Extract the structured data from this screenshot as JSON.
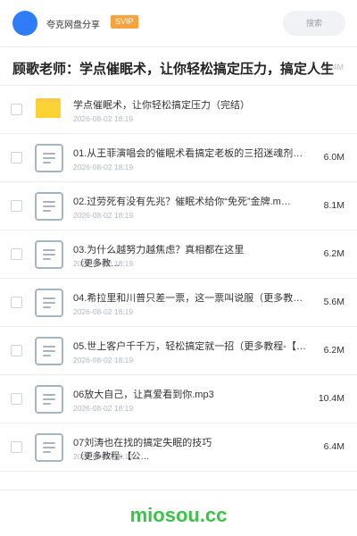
{
  "header": {
    "share_name": "夸克网盘分享",
    "badge": "SVIP",
    "search_label": "搜索"
  },
  "title": {
    "text": "顾歌老师：学点催眠术，让你轻松搞定压力，搞定人生",
    "size": "58.4M"
  },
  "files": [
    {
      "name": "学点催眠术，让你轻松搞定压力（完结）",
      "name2": "",
      "date": "2026-08-02 18:19",
      "size": "",
      "type": "folder"
    },
    {
      "name": "01.从王菲演唱会的催眠术看搞定老板的三招迷魂剂…",
      "name2": "",
      "date": "2026-08-02 18:19",
      "size": "6.0M",
      "type": "doc"
    },
    {
      "name": "02.过劳死有没有先兆？催眠术给你“免死”金牌.m…",
      "name2": "",
      "date": "2026-08-02 18:19",
      "size": "8.1M",
      "type": "doc"
    },
    {
      "name": "03.为什么越努力越焦虑？真相都在这里",
      "name2": "（更多教…",
      "date": "2026-08-02 18:19",
      "size": "6.2M",
      "type": "doc"
    },
    {
      "name": "04.希拉里和川普只差一票，这一票叫说服（更多教程…",
      "name2": "",
      "date": "2026-08-02 18:19",
      "size": "5.6M",
      "type": "doc"
    },
    {
      "name": "05.世上客户千千万，轻松搞定就一招（更多教程-【…",
      "name2": "",
      "date": "2026-08-02 18:19",
      "size": "6.2M",
      "type": "doc"
    },
    {
      "name": "06放大自己，让真爱看到你.mp3",
      "name2": "",
      "date": "2026-08-02 18:19",
      "size": "10.4M",
      "type": "doc"
    },
    {
      "name": "07刘涛也在找的搞定失眠的技巧",
      "name2": "（更多教程-【公…",
      "date": "2026-08-02 18:19",
      "size": "6.4M",
      "type": "doc"
    }
  ],
  "footer": {
    "brand": "miosou.cc"
  },
  "colors": {
    "accent_blue": "#2e7cf6",
    "svip_orange": "#f7a23b",
    "folder_yellow": "#fbd234",
    "brand_green": "#3cc14a"
  }
}
